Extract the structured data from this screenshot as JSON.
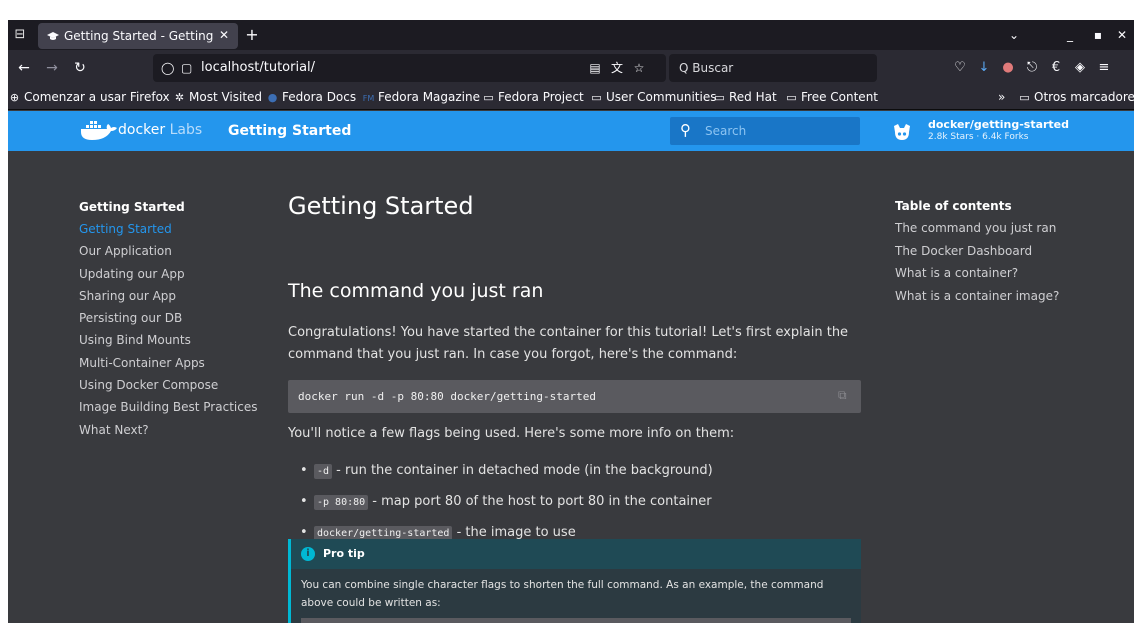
{
  "browser": {
    "tab": {
      "title": "Getting Started - Getting"
    },
    "url": "localhost/tutorial/",
    "search_placeholder": "Q Buscar",
    "bookmarks": [
      {
        "label": "Comenzar a usar Firefox",
        "icon": "globe-icon"
      },
      {
        "label": "Most Visited",
        "icon": "gear-icon"
      },
      {
        "label": "Fedora Docs",
        "icon": "fedora-icon"
      },
      {
        "label": "Fedora Magazine",
        "icon": "fm-icon"
      },
      {
        "label": "Fedora Project",
        "icon": "folder-icon"
      },
      {
        "label": "User Communities",
        "icon": "folder-icon"
      },
      {
        "label": "Red Hat",
        "icon": "folder-icon"
      },
      {
        "label": "Free Content",
        "icon": "folder-icon"
      }
    ],
    "overflow_label": "»",
    "other_bookmarks": "Otros marcadores"
  },
  "site": {
    "logo_text": "docker",
    "logo_labs": "Labs",
    "title": "Getting Started",
    "search_placeholder": "Search",
    "repo": {
      "name": "docker/getting-started",
      "stats": "2.8k Stars · 6.4k Forks"
    },
    "brand_color": "#2496ed"
  },
  "nav": {
    "heading": "Getting Started",
    "items": [
      "Getting Started",
      "Our Application",
      "Updating our App",
      "Sharing our App",
      "Persisting our DB",
      "Using Bind Mounts",
      "Multi-Container Apps",
      "Using Docker Compose",
      "Image Building Best Practices",
      "What Next?"
    ],
    "active_index": 0
  },
  "article": {
    "h1": "Getting Started",
    "h2": "The command you just ran",
    "intro": "Congratulations! You have started the container for this tutorial! Let's first explain the command that you just ran. In case you forgot, here's the command:",
    "command": "docker run -d -p 80:80 docker/getting-started",
    "flags_intro": "You'll notice a few flags being used. Here's some more info on them:",
    "flags": [
      {
        "code": "-d",
        "text": " - run the container in detached mode (in the background)"
      },
      {
        "code": "-p 80:80",
        "text": " - map port 80 of the host to port 80 in the container"
      },
      {
        "code": "docker/getting-started",
        "text": " - the image to use"
      }
    ],
    "tip": {
      "title": "Pro tip",
      "body": "You can combine single character flags to shorten the full command. As an example, the command above could be written as:"
    }
  },
  "toc": {
    "heading": "Table of contents",
    "items": [
      "The command you just ran",
      "The Docker Dashboard",
      "What is a container?",
      "What is a container image?"
    ]
  }
}
